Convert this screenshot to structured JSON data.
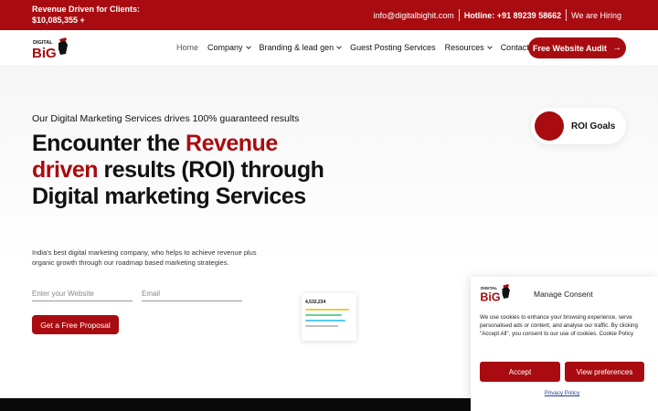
{
  "topbar": {
    "revenue_text": "Revenue Driven for Clients: $10,085,355 +",
    "email": "info@digitalbighit.com",
    "hotline": "Hotline: +91 89239 58662",
    "hiring": "We are Hiring"
  },
  "brand": {
    "logo_text": "DIGITAL BIG",
    "accent_color": "#a80c10"
  },
  "nav": {
    "items": [
      {
        "label": "Home",
        "dropdown": false
      },
      {
        "label": "Company",
        "dropdown": true
      },
      {
        "label": "Branding & lead gen",
        "dropdown": true
      },
      {
        "label": "Guest Posting Services",
        "dropdown": false
      },
      {
        "label": "Resources",
        "dropdown": true
      },
      {
        "label": "Contact Us",
        "dropdown": false
      }
    ],
    "cta_label": "Free Website Audit"
  },
  "hero": {
    "subtitle": "Our Digital Marketing Services drives 100% guaranteed results",
    "headline_1": "Encounter the ",
    "headline_red": "Revenue driven",
    "headline_2": " results (ROI) through Digital marketing Services",
    "description": "India's best digital marketing company, who helps to achieve revenue plus organic growth through our roadmap based marketing strategies.",
    "website_placeholder": "Enter your Website",
    "email_placeholder": "Email",
    "proposal_button": "Get a Free Proposal",
    "roi_label": "ROI Goals",
    "mini_card_value": "4,532,234"
  },
  "cookie": {
    "title": "Manage Consent",
    "text": "We use cookies to enhance your browsing experience, serve personalised ads or content, and analyse our traffic. By clicking \"Accept All\", you consent to our use of cookies. Cookie Policy",
    "accept_label": "Accept",
    "prefs_label": "View preferences",
    "policy_label": "Privacy Policy"
  }
}
